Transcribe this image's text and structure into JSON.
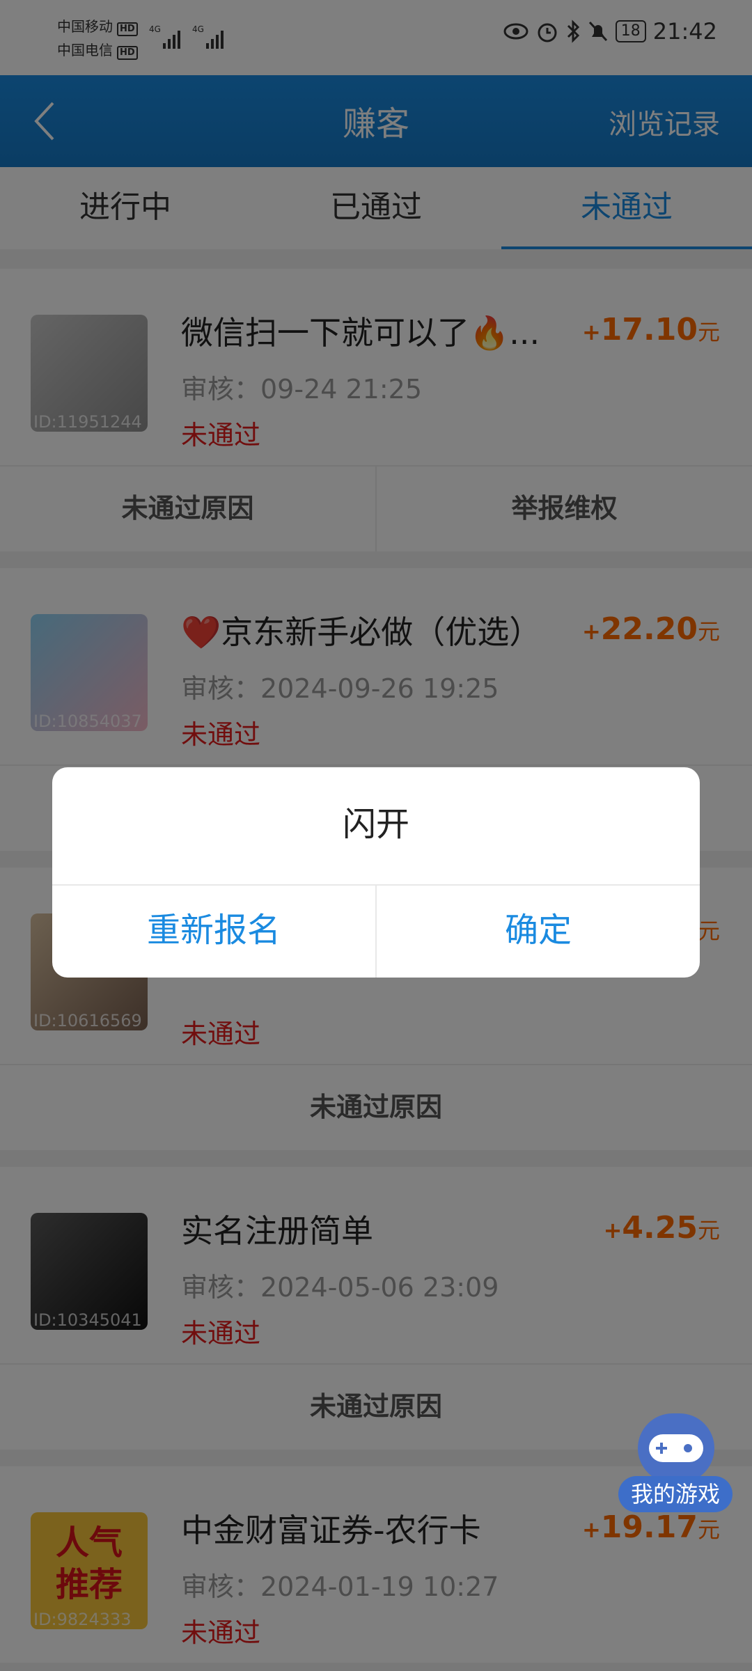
{
  "status_bar": {
    "carrier1": "中国移动",
    "carrier2": "中国电信",
    "hd": "HD",
    "net": "4G",
    "battery": "18",
    "time": "21:42"
  },
  "header": {
    "title": "赚客",
    "history_label": "浏览记录"
  },
  "tabs": [
    {
      "label": "进行中",
      "active": false
    },
    {
      "label": "已通过",
      "active": false
    },
    {
      "label": "未通过",
      "active": true
    }
  ],
  "tasks": [
    {
      "title": "微信扫一下就可以了🔥...",
      "reward_sign": "+",
      "reward": "17.10",
      "unit": "元",
      "review": "审核：09-24 21:25",
      "status": "未通过",
      "thumb_id": "ID:11951244",
      "actions": [
        "未通过原因",
        "举报维权"
      ]
    },
    {
      "title": "❤️京东新手必做（优选）",
      "reward_sign": "+",
      "reward": "22.20",
      "unit": "元",
      "review": "审核：2024-09-26 19:25",
      "status": "未通过",
      "thumb_id": "ID:10854037",
      "actions": []
    },
    {
      "title": "",
      "reward_sign": "",
      "reward": "",
      "unit": "元",
      "review": "",
      "status": "未通过",
      "thumb_id": "ID:10616569",
      "actions": [
        "未通过原因"
      ]
    },
    {
      "title": "实名注册简单",
      "reward_sign": "+",
      "reward": "4.25",
      "unit": "元",
      "review": "审核：2024-05-06 23:09",
      "status": "未通过",
      "thumb_id": "ID:10345041",
      "actions": [
        "未通过原因"
      ]
    },
    {
      "title": "中金财富证券-农行卡",
      "reward_sign": "+",
      "reward": "19.17",
      "unit": "元",
      "review": "审核：2024-01-19 10:27",
      "status": "未通过",
      "thumb_id": "ID:9824333",
      "thumb_text": [
        "人气",
        "推荐"
      ],
      "actions": []
    }
  ],
  "floating": {
    "game_label": "我的游戏"
  },
  "dialog": {
    "message": "闪开",
    "buttons": [
      "重新报名",
      "确定"
    ]
  },
  "colors": {
    "accent": "#1a8ae0",
    "reward": "#ff6a00",
    "fail": "#e21d1d"
  }
}
